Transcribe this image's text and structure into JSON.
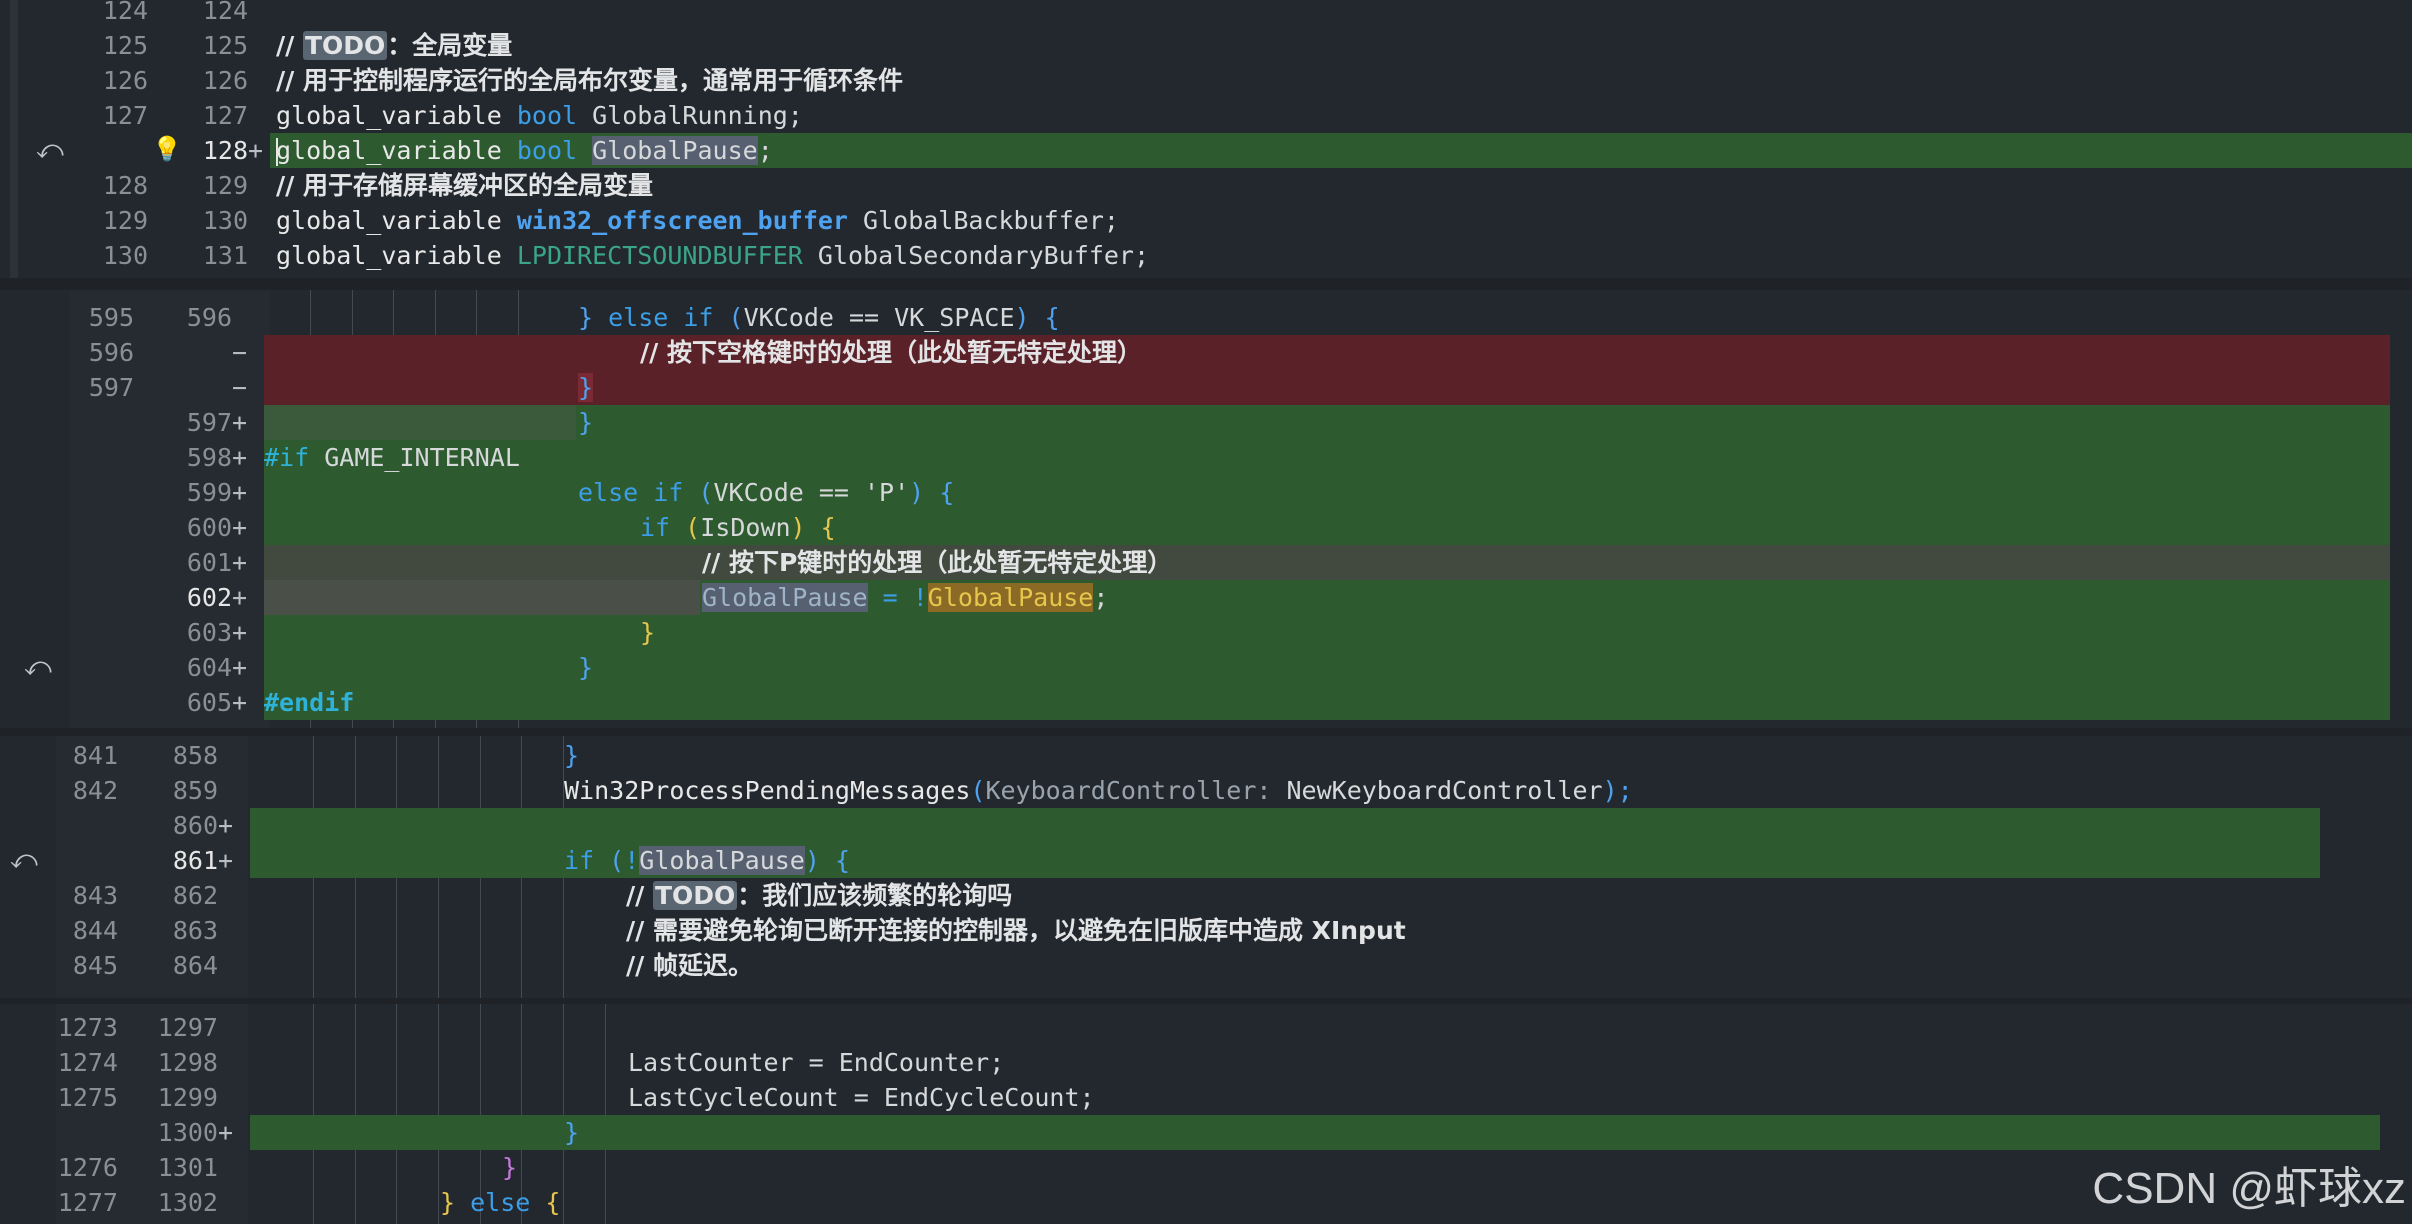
{
  "hunk1": {
    "lines": [
      {
        "old": "124",
        "new": "124"
      },
      {
        "old": "125",
        "new": "125"
      },
      {
        "old": "126",
        "new": "126"
      },
      {
        "old": "127",
        "new": "127"
      },
      {
        "old": "",
        "new": "128",
        "mark": "+"
      },
      {
        "old": "128",
        "new": "129"
      },
      {
        "old": "129",
        "new": "130"
      },
      {
        "old": "130",
        "new": "131"
      }
    ],
    "todo_label": "TODO",
    "c_global_comment": "：全局变量",
    "c_bool_comment": "// 用于控制程序运行的全局布尔变量，通常用于循环条件",
    "kw_global_variable": "global_variable",
    "kw_bool": "bool",
    "id_running": "GlobalRunning;",
    "id_pause": "GlobalPause",
    "semi": ";",
    "c_buffer_comment": "// 用于存储屏幕缓冲区的全局变量",
    "ty_offscreen": "win32_offscreen_buffer",
    "id_backbuffer": "GlobalBackbuffer;",
    "ty_dsound": "LPDIRECTSOUNDBUFFER",
    "id_secondary": "GlobalSecondaryBuffer;"
  },
  "hunk2": {
    "lines": [
      {
        "old": "595",
        "new": "596"
      },
      {
        "old": "596",
        "new": "",
        "mark": "−"
      },
      {
        "old": "597",
        "new": "",
        "mark": "−"
      },
      {
        "old": "",
        "new": "597",
        "mark": "+"
      },
      {
        "old": "",
        "new": "598",
        "mark": "+"
      },
      {
        "old": "",
        "new": "599",
        "mark": "+"
      },
      {
        "old": "",
        "new": "600",
        "mark": "+"
      },
      {
        "old": "",
        "new": "601",
        "mark": "+"
      },
      {
        "old": "",
        "new": "602",
        "mark": "+"
      },
      {
        "old": "",
        "new": "603",
        "mark": "+"
      },
      {
        "old": "",
        "new": "604",
        "mark": "+"
      },
      {
        "old": "",
        "new": "605",
        "mark": "+"
      }
    ],
    "rbrace": "}",
    "lbrace": "{",
    "kw_else_if": "else if",
    "vk_space_expr": "VKCode == VK_SPACE",
    "lparen": "(",
    "rparen": ")",
    "c_space": "// 按下空格键时的处理（此处暂无特定处理）",
    "pp_if": "#if",
    "game_internal": "GAME_INTERNAL",
    "vk_p_expr": "VKCode == 'P'",
    "kw_if": "if",
    "isdown": "IsDown",
    "c_p": "// 按下P键时的处理（此处暂无特定处理）",
    "id_pause": "GlobalPause",
    "assign_not": " = !",
    "semi": ";",
    "pp_endif": "#endif"
  },
  "hunk3": {
    "lines": [
      {
        "old": "841",
        "new": "858"
      },
      {
        "old": "842",
        "new": "859"
      },
      {
        "old": "",
        "new": "860",
        "mark": "+"
      },
      {
        "old": "",
        "new": "861",
        "mark": "+"
      },
      {
        "old": "843",
        "new": "862"
      },
      {
        "old": "844",
        "new": "863"
      },
      {
        "old": "845",
        "new": "864"
      }
    ],
    "rbrace": "}",
    "fn_pending": "Win32ProcessPendingMessages",
    "param_hint": "KeyboardController:",
    "arg": " NewKeyboardController",
    "close": ");",
    "kw_if": "if",
    "not": "!",
    "id_pause": "GlobalPause",
    "lbrace": "{",
    "todo_label": "TODO",
    "c_poll": "：我们应该频繁的轮询吗",
    "c_avoid": "// 需要避免轮询已断开连接的控制器，以避免在旧版库中造成 XInput",
    "c_lag": "// 帧延迟。"
  },
  "hunk4": {
    "lines": [
      {
        "old": "1273",
        "new": "1297"
      },
      {
        "old": "1274",
        "new": "1298"
      },
      {
        "old": "1275",
        "new": "1299"
      },
      {
        "old": "",
        "new": "1300",
        "mark": "+"
      },
      {
        "old": "1276",
        "new": "1301"
      },
      {
        "old": "1277",
        "new": "1302"
      }
    ],
    "last_counter": "LastCounter = EndCounter;",
    "last_cycle": "LastCycleCount = EndCycleCount;",
    "rbrace": "}",
    "kw_else": "else",
    "lbrace": "{"
  },
  "watermark": "CSDN @虾球xz",
  "colors": {
    "added": "#2e5a30",
    "removed": "#5a2128",
    "background": "#1f2328"
  }
}
